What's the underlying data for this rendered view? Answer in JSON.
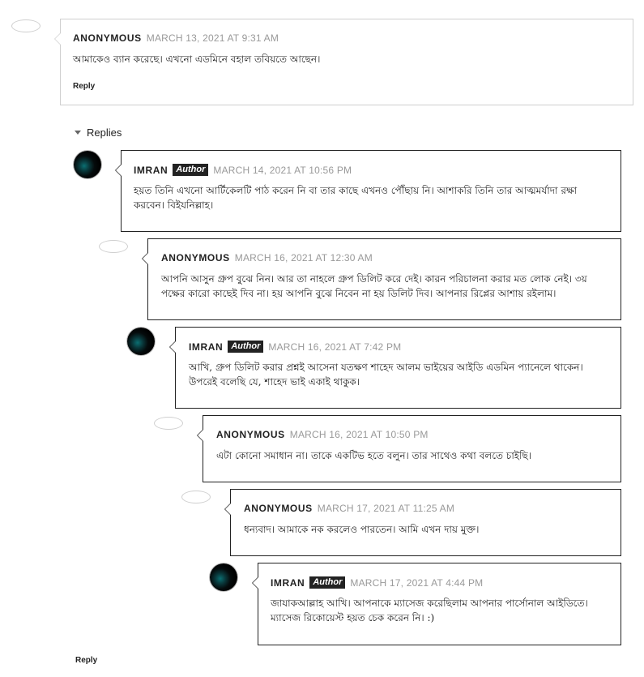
{
  "comments": [
    {
      "name": "ANONYMOUS",
      "badge": "",
      "date": "MARCH 13, 2021 AT 9:31 AM",
      "text": "আমাকেও ব্যান করেছে। এখনো এডমিনে বহাল তবিয়তে আছেন।",
      "reply": "Reply"
    },
    {
      "name": "IMRAN",
      "badge": "Author",
      "date": "MARCH 14, 2021 AT 10:56 PM",
      "text": "হয়ত তিনি এখনো আর্টিকেলটি পাঠ করেন নি বা তার কাছে এখনও পৌঁছায় নি। আশাকরি তিনি তার আত্মমর্যাদা রক্ষা করবেন। বিইযনিল্লাহ।"
    },
    {
      "name": "ANONYMOUS",
      "badge": "",
      "date": "MARCH 16, 2021 AT 12:30 AM",
      "text": "আপনি আসুন গ্রুপ বুঝে নিন। আর তা নাহলে গ্রুপ ডিলিট করে দেই। কারন পরিচালনা করার মত লোক নেই। ৩য় পক্ষের কারো কাছেই দিব না। হয় আপনি বুঝে নিবেন না হয় ডিলিট দিব। আপনার রিপ্লের আশায় রইলাম।"
    },
    {
      "name": "IMRAN",
      "badge": "Author",
      "date": "MARCH 16, 2021 AT 7:42 PM",
      "text": "আখি, গ্রুপ ডিলিট করার প্রশ্নই আসেনা যতক্ষণ শাহেদ আলম ভাইয়ের আইডি এডমিন প্যানেলে থাকেন। উপরেই বলেছি যে, শাহেদ ভাই একাই থাকুক।"
    },
    {
      "name": "ANONYMOUS",
      "badge": "",
      "date": "MARCH 16, 2021 AT 10:50 PM",
      "text": "এটা কোনো সমাধান না। তাকে একটিভ হতে বলুন। তার সাথেও কথা বলতে চাইছি।"
    },
    {
      "name": "ANONYMOUS",
      "badge": "",
      "date": "MARCH 17, 2021 AT 11:25 AM",
      "text": "ধন্যবাদ। আমাকে নক করলেও পারতেন। আমি এখন দায় মুক্ত।"
    },
    {
      "name": "IMRAN",
      "badge": "Author",
      "date": "MARCH 17, 2021 AT 4:44 PM",
      "text": "জাযাকআল্লাহ আখি। আপনাকে ম্যাসেজ করেছিলাম আপনার পার্সোনাল আইডিতে। ম্যাসেজ রিকোয়েস্ট হয়ত চেক করেন নি। :)"
    }
  ],
  "replies_toggle_label": "Replies",
  "thread_reply_label": "Reply"
}
